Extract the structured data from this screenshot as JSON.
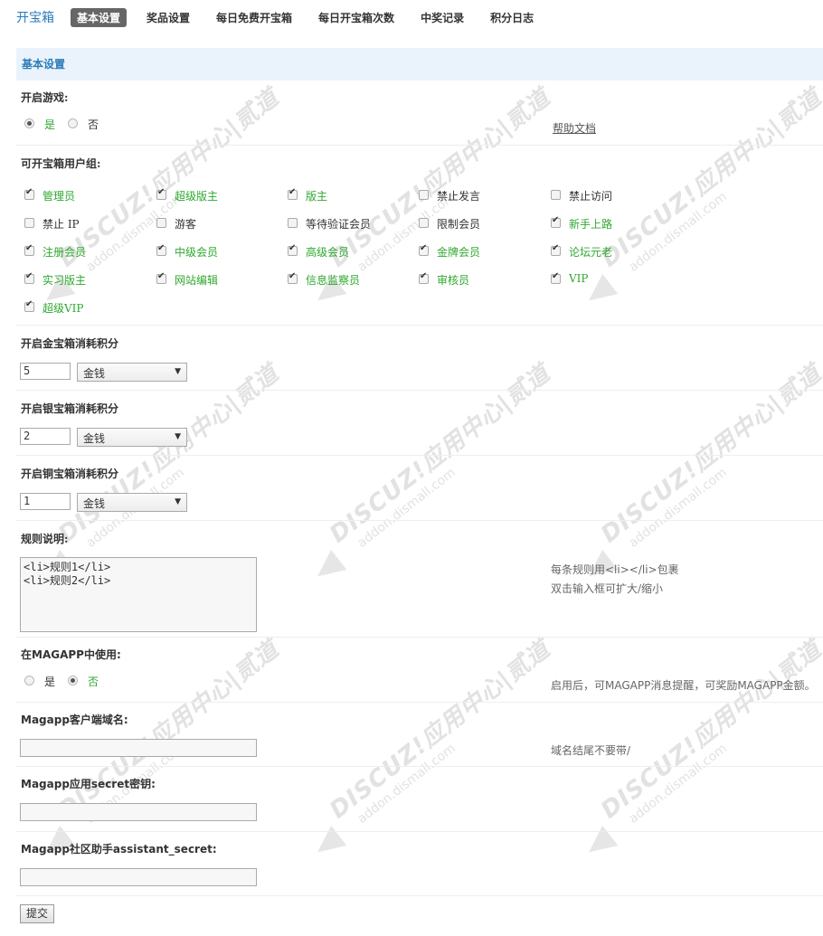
{
  "app_title": "开宝箱",
  "tabs": [
    "基本设置",
    "奖品设置",
    "每日免费开宝箱",
    "每日开宝箱次数",
    "中奖记录",
    "积分日志"
  ],
  "section_title": "基本设置",
  "watermark": {
    "main": "DISCUZ!应用中心|贰道",
    "sub": "addon.dismall.com"
  },
  "open_game": {
    "label": "开启游戏:",
    "options": [
      "是",
      "否"
    ],
    "selected": "是",
    "help_link": "帮助文档"
  },
  "user_groups": {
    "label": "可开宝箱用户组:",
    "items": [
      {
        "name": "管理员",
        "checked": true
      },
      {
        "name": "超级版主",
        "checked": true
      },
      {
        "name": "版主",
        "checked": true
      },
      {
        "name": "禁止发言",
        "checked": false
      },
      {
        "name": "禁止访问",
        "checked": false
      },
      {
        "name": "禁止 IP",
        "checked": false
      },
      {
        "name": "游客",
        "checked": false
      },
      {
        "name": "等待验证会员",
        "checked": false
      },
      {
        "name": "限制会员",
        "checked": false
      },
      {
        "name": "新手上路",
        "checked": true
      },
      {
        "name": "注册会员",
        "checked": true
      },
      {
        "name": "中级会员",
        "checked": true
      },
      {
        "name": "高级会员",
        "checked": true
      },
      {
        "name": "金牌会员",
        "checked": true
      },
      {
        "name": "论坛元老",
        "checked": true
      },
      {
        "name": "实习版主",
        "checked": true
      },
      {
        "name": "网站编辑",
        "checked": true
      },
      {
        "name": "信息监察员",
        "checked": true
      },
      {
        "name": "审核员",
        "checked": true
      },
      {
        "name": "VIP",
        "checked": true
      },
      {
        "name": "超级VIP",
        "checked": true
      }
    ]
  },
  "gold_box": {
    "label": "开启金宝箱消耗积分",
    "value": "5",
    "currency": "金钱"
  },
  "silver_box": {
    "label": "开启银宝箱消耗积分",
    "value": "2",
    "currency": "金钱"
  },
  "copper_box": {
    "label": "开启铜宝箱消耗积分",
    "value": "1",
    "currency": "金钱"
  },
  "rules": {
    "label": "规则说明:",
    "value": "<li>规则1</li>\n<li>规则2</li>",
    "hint1": "每条规则用<li></li>包裹",
    "hint2": "双击输入框可扩大/缩小"
  },
  "magapp_use": {
    "label": "在MAGAPP中使用:",
    "options": [
      "是",
      "否"
    ],
    "selected": "否",
    "hint": "启用后，可MAGAPP消息提醒，可奖励MAGAPP金额。"
  },
  "magapp_domain": {
    "label": "Magapp客户端域名:",
    "value": "",
    "hint": "域名结尾不要带/"
  },
  "magapp_secret": {
    "label": "Magapp应用secret密钥:",
    "value": ""
  },
  "magapp_assistant": {
    "label": "Magapp社区助手assistant_secret:",
    "value": ""
  },
  "submit_label": "提交",
  "colors": {
    "accent": "#2b7bb9",
    "checked_label": "#2fa82f",
    "header_bg": "#eaf3fb"
  }
}
